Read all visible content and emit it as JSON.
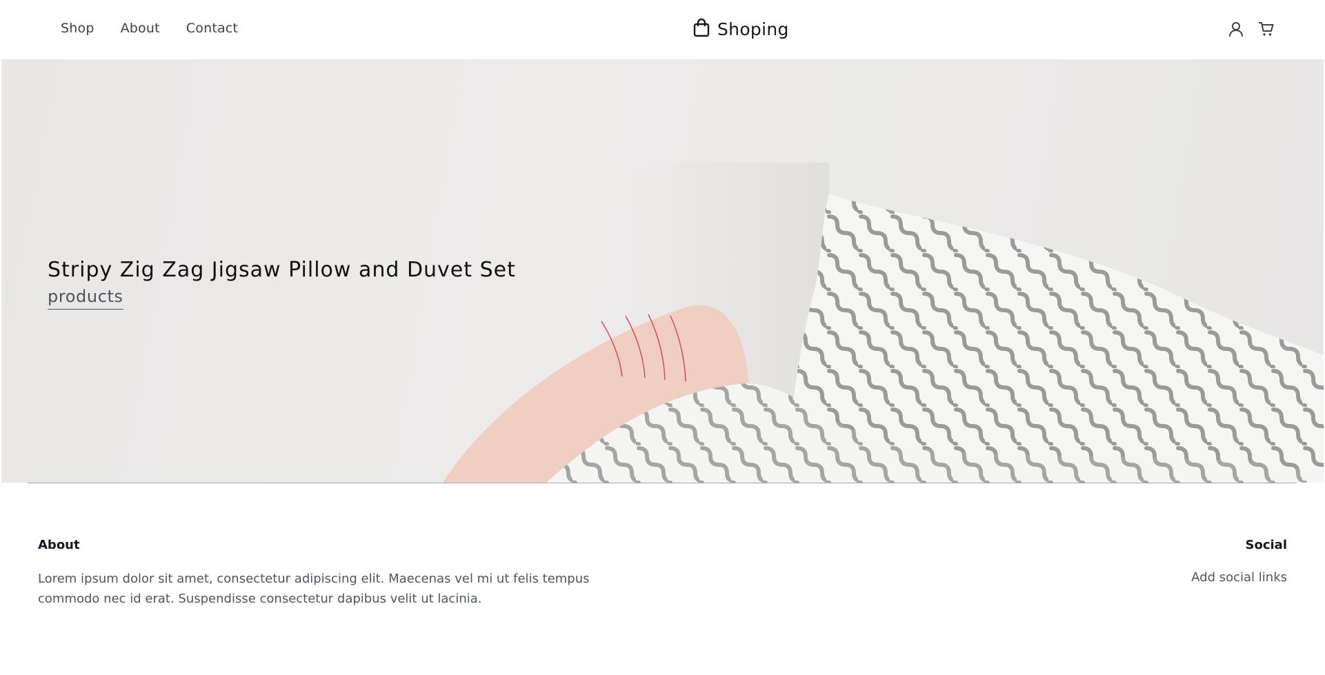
{
  "header": {
    "nav": [
      {
        "label": "Shop"
      },
      {
        "label": "About"
      },
      {
        "label": "Contact"
      }
    ],
    "brand": {
      "name": "Shoping",
      "icon": "shopping-bag-icon"
    },
    "icons": [
      "user-icon",
      "cart-icon"
    ]
  },
  "hero": {
    "title": "Stripy Zig Zag Jigsaw Pillow and Duvet Set",
    "link": "products"
  },
  "footer": {
    "about": {
      "title": "About",
      "text": "Lorem ipsum dolor sit amet, consectetur adipiscing elit. Maecenas vel mi ut felis tempus commodo nec id erat. Suspendisse consectetur dapibus velit ut lacinia."
    },
    "social": {
      "title": "Social",
      "link": "Add social links"
    }
  },
  "colors": {
    "text": "#1f2937",
    "muted": "#4b5563",
    "hero_bg": "#ebeae9",
    "rule": "#9aa7c0"
  }
}
